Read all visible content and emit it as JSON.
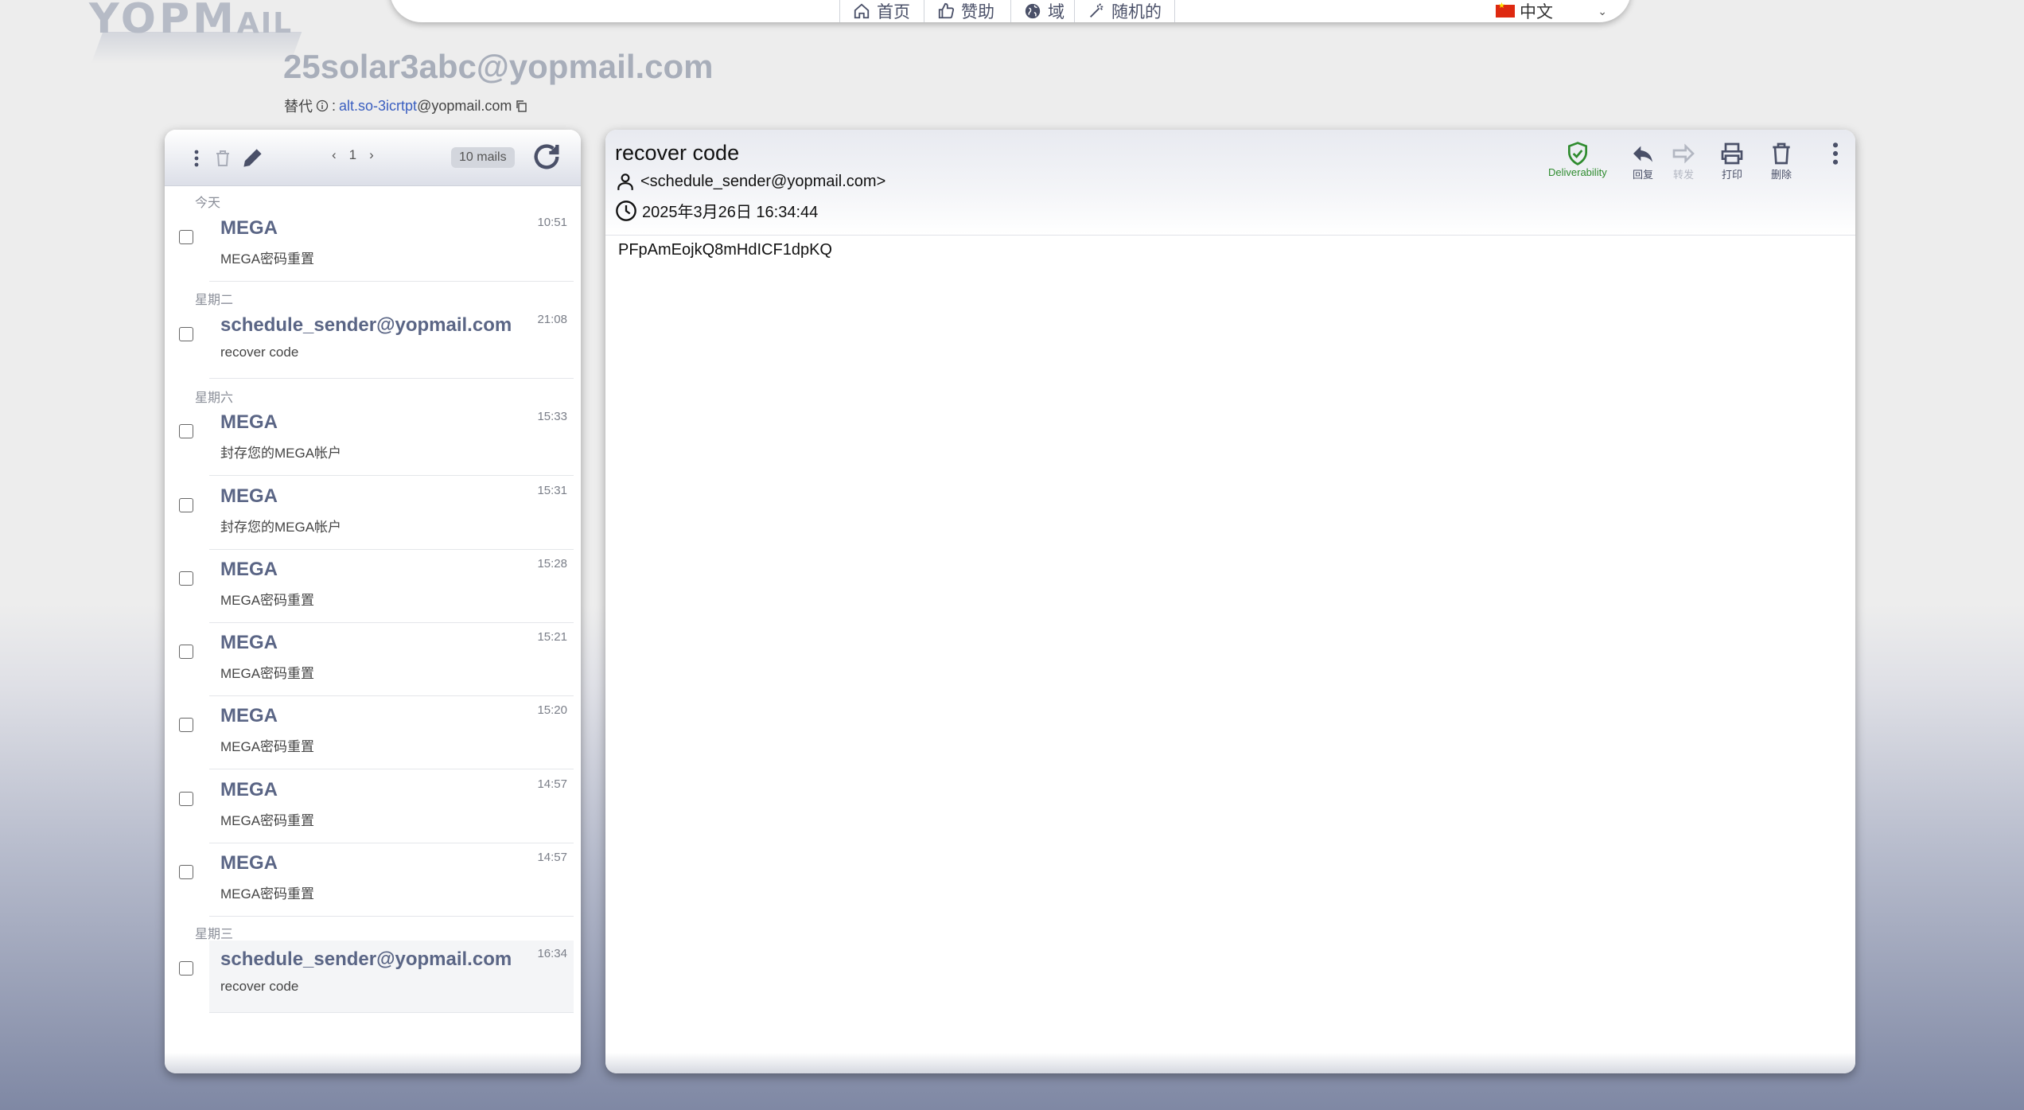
{
  "logo": {
    "text_main": "YOPM",
    "text_small": "AIL"
  },
  "nav": [
    {
      "label": "首页",
      "icon": "home-icon"
    },
    {
      "label": "赞助",
      "icon": "thumbs-up-icon"
    },
    {
      "label": "域",
      "icon": "globe-icon"
    },
    {
      "label": "随机的",
      "icon": "magic-wand-icon"
    }
  ],
  "language": {
    "label": "中文",
    "flag": "china-flag-icon"
  },
  "inbox": {
    "address": "25solar3abc@yopmail.com",
    "alias_label": "替代",
    "alias_name": "alt.so-3icrtpt",
    "alias_domain": "@yopmail.com"
  },
  "list_toolbar": {
    "page": "1",
    "count": "10 mails"
  },
  "mails": [
    {
      "day": "今天",
      "from": "MEGA",
      "subject": "MEGA密码重置",
      "time": "10:51"
    },
    {
      "day": "星期二",
      "from": "schedule_sender@yopmail.com",
      "subject": "recover code",
      "time": "21:08"
    },
    {
      "day": "星期六",
      "from": "MEGA",
      "subject": "封存您的MEGA帐户",
      "time": "15:33"
    },
    {
      "day": "",
      "from": "MEGA",
      "subject": "封存您的MEGA帐户",
      "time": "15:31"
    },
    {
      "day": "",
      "from": "MEGA",
      "subject": "MEGA密码重置",
      "time": "15:28"
    },
    {
      "day": "",
      "from": "MEGA",
      "subject": "MEGA密码重置",
      "time": "15:21"
    },
    {
      "day": "",
      "from": "MEGA",
      "subject": "MEGA密码重置",
      "time": "15:20"
    },
    {
      "day": "",
      "from": "MEGA",
      "subject": "MEGA密码重置",
      "time": "14:57"
    },
    {
      "day": "",
      "from": "MEGA",
      "subject": "MEGA密码重置",
      "time": "14:57"
    },
    {
      "day": "星期三",
      "from": "schedule_sender@yopmail.com",
      "subject": "recover code",
      "time": "16:34",
      "selected": true
    }
  ],
  "message": {
    "subject": "recover code",
    "from": "<schedule_sender@yopmail.com>",
    "date": "2025年3月26日 16:34:44",
    "body": "PFpAmEojkQ8mHdICF1dpKQ"
  },
  "actions": {
    "deliverability": "Deliverability",
    "reply": "回复",
    "forward": "转发",
    "print": "打印",
    "delete": "删除"
  },
  "colors": {
    "accent": "#5a6585",
    "deliverability": "#2e8b2e"
  }
}
